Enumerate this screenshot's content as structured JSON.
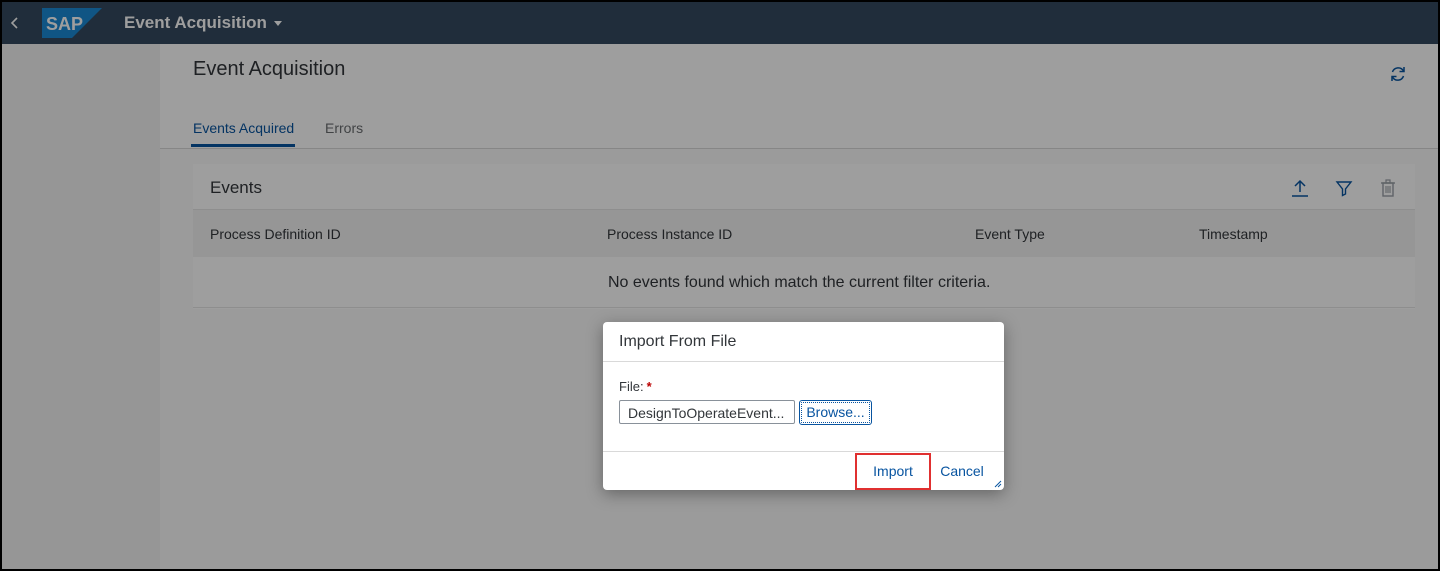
{
  "shell": {
    "logo_text": "SAP",
    "app_title": "Event Acquisition"
  },
  "header": {
    "page_title": "Event Acquisition",
    "tabs": [
      {
        "label": "Events Acquired",
        "selected": true
      },
      {
        "label": "Errors",
        "selected": false
      }
    ]
  },
  "events": {
    "title": "Events",
    "toolbar_icons": [
      "upload-icon",
      "filter-icon",
      "delete-icon"
    ],
    "columns": [
      "Process Definition ID",
      "Process Instance ID",
      "Event Type",
      "Timestamp"
    ],
    "no_data_text": "No events found which match the current filter criteria."
  },
  "dialog": {
    "title": "Import From File",
    "file_label": "File:",
    "required_marker": "*",
    "file_value": "DesignToOperateEvent...",
    "browse_label": "Browse...",
    "import_label": "Import",
    "cancel_label": "Cancel"
  },
  "colors": {
    "shell_bg": "#354a5f",
    "accent": "#0854a0",
    "highlight": "#e03030"
  }
}
